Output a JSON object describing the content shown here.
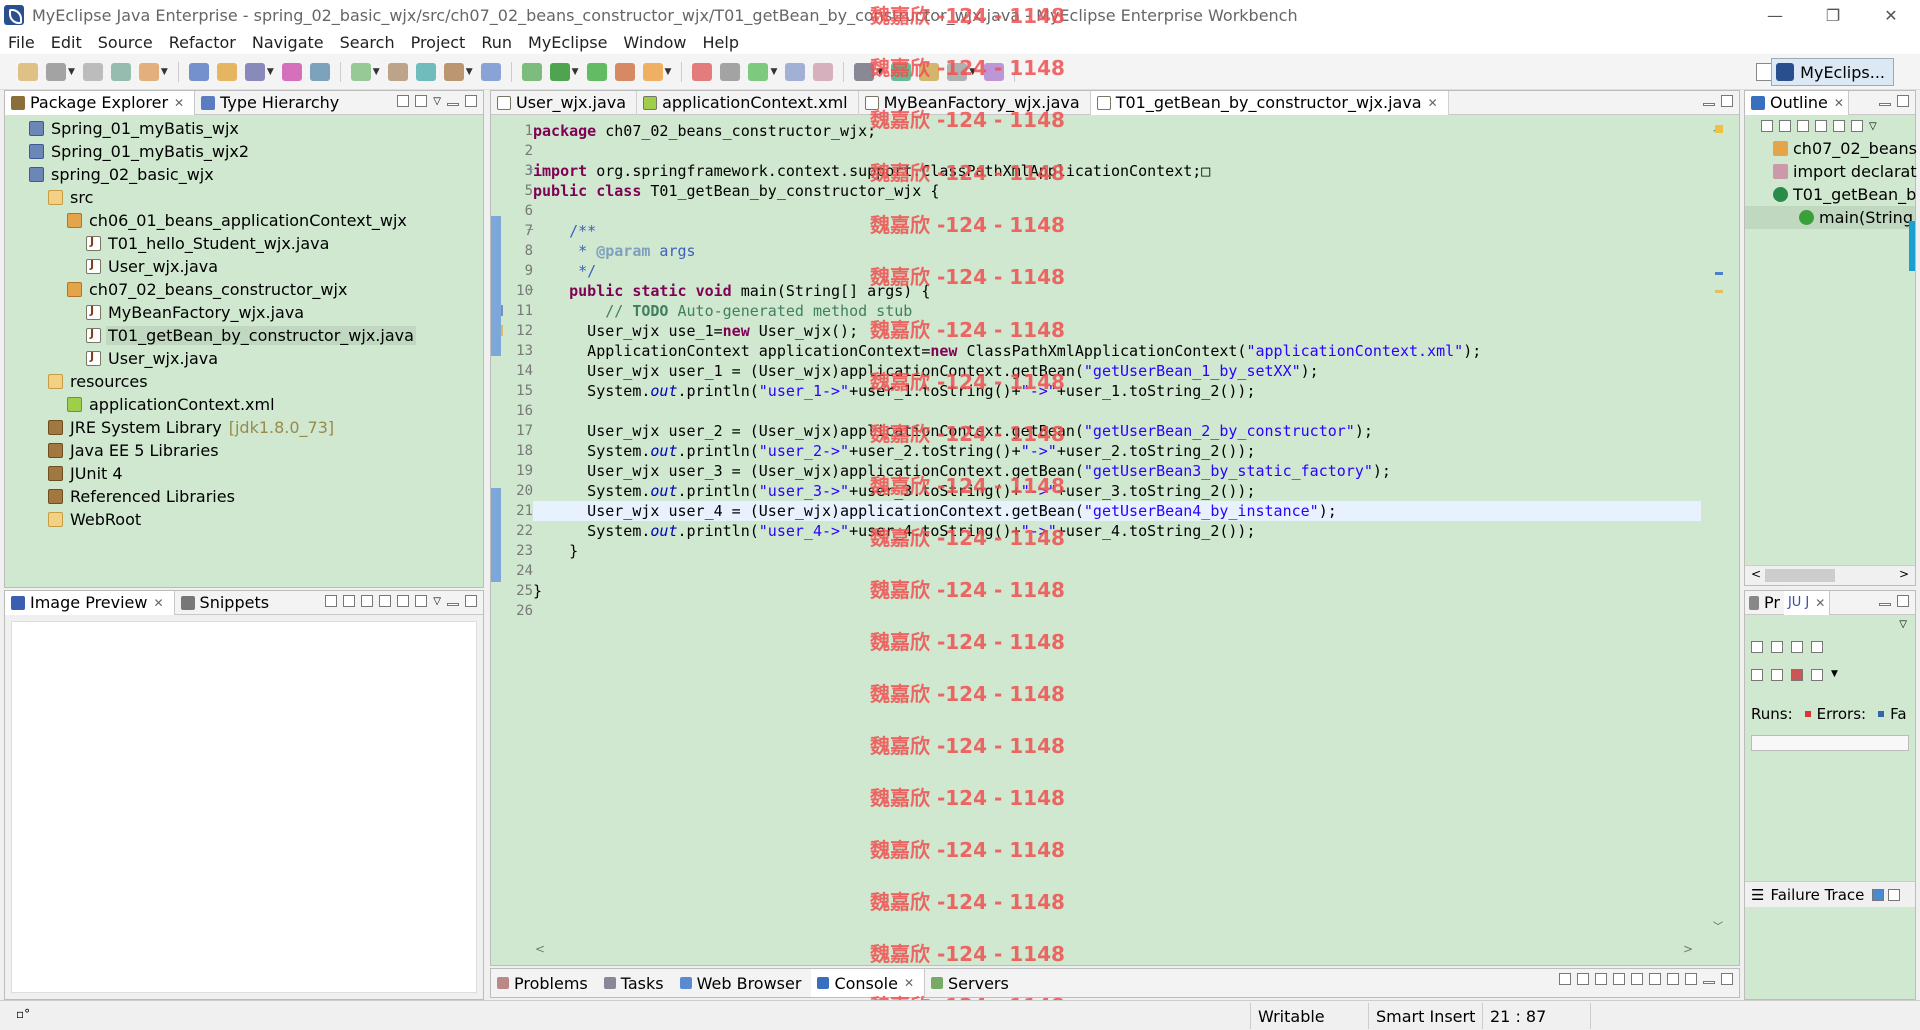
{
  "window": {
    "title": "MyEclipse Java Enterprise - spring_02_basic_wjx/src/ch07_02_beans_constructor_wjx/T01_getBean_by_constructor_wjx.java - MyEclipse Enterprise Workbench",
    "controls": [
      "—",
      "❐",
      "✕"
    ]
  },
  "menu": [
    "File",
    "Edit",
    "Source",
    "Refactor",
    "Navigate",
    "Search",
    "Project",
    "Run",
    "MyEclipse",
    "Window",
    "Help"
  ],
  "perspective": {
    "label": "MyEclips..."
  },
  "package_explorer": {
    "tabs": [
      {
        "label": "Package Explorer"
      },
      {
        "label": "Type Hierarchy"
      }
    ],
    "items": [
      {
        "label": "Spring_01_myBatis_wjx",
        "indent": 0,
        "icon": "project"
      },
      {
        "label": "Spring_01_myBatis_wjx2",
        "indent": 0,
        "icon": "project"
      },
      {
        "label": "spring_02_basic_wjx",
        "indent": 0,
        "icon": "project"
      },
      {
        "label": "src",
        "indent": 1,
        "icon": "folder"
      },
      {
        "label": "ch06_01_beans_applicationContext_wjx",
        "indent": 2,
        "icon": "package"
      },
      {
        "label": "T01_hello_Student_wjx.java",
        "indent": 3,
        "icon": "java-file"
      },
      {
        "label": "User_wjx.java",
        "indent": 3,
        "icon": "java-file"
      },
      {
        "label": "ch07_02_beans_constructor_wjx",
        "indent": 2,
        "icon": "package"
      },
      {
        "label": "MyBeanFactory_wjx.java",
        "indent": 3,
        "icon": "java-file"
      },
      {
        "label": "T01_getBean_by_constructor_wjx.java",
        "indent": 3,
        "icon": "java-file",
        "selected": true
      },
      {
        "label": "User_wjx.java",
        "indent": 3,
        "icon": "java-file"
      },
      {
        "label": "resources",
        "indent": 1,
        "icon": "folder"
      },
      {
        "label": "applicationContext.xml",
        "indent": 2,
        "icon": "xml-file"
      },
      {
        "label": "JRE System Library",
        "decor": "[jdk1.8.0_73]",
        "indent": 1,
        "icon": "library"
      },
      {
        "label": "Java EE 5 Libraries",
        "indent": 1,
        "icon": "library"
      },
      {
        "label": "JUnit 4",
        "indent": 1,
        "icon": "library"
      },
      {
        "label": "Referenced Libraries",
        "indent": 1,
        "icon": "library"
      },
      {
        "label": "WebRoot",
        "indent": 1,
        "icon": "folder"
      }
    ]
  },
  "image_preview": {
    "tabs": [
      {
        "label": "Image Preview"
      },
      {
        "label": "Snippets"
      }
    ]
  },
  "editor": {
    "tabs": [
      {
        "label": "User_wjx.java"
      },
      {
        "label": "applicationContext.xml"
      },
      {
        "label": "MyBeanFactory_wjx.java"
      },
      {
        "label": "T01_getBean_by_constructor_wjx.java",
        "active": true
      }
    ],
    "lines": [
      {
        "n": "1",
        "html": "<span class='kw'>package</span> ch07_02_beans_constructor_wjx;"
      },
      {
        "n": "2",
        "html": ""
      },
      {
        "n": "3",
        "html": "<span class='kw'>import</span> org.springframework.context.support.ClassPathXmlApplicationContext;&#9633;"
      },
      {
        "n": "5",
        "html": "<span class='kw'>public</span> <span class='kw'>class</span> T01_getBean_by_constructor_wjx {"
      },
      {
        "n": "6",
        "html": ""
      },
      {
        "n": "7",
        "html": "    <span class='doc'>/**</span>"
      },
      {
        "n": "8",
        "html": "     <span class='doc'>* </span><span class='doctag'>@param</span><span class='doc'> args</span>"
      },
      {
        "n": "9",
        "html": "     <span class='doc'>*/</span>"
      },
      {
        "n": "10",
        "html": "    <span class='kw'>public</span> <span class='kw'>static</span> <span class='kw'>void</span> main(String[] args) {"
      },
      {
        "n": "11",
        "html": "        <span class='cm'>// <b>TODO</b> Auto-generated method stub</span>"
      },
      {
        "n": "12",
        "html": "      User_wjx use_1=<span class='kw'>new</span> User_wjx();"
      },
      {
        "n": "13",
        "html": "      ApplicationContext applicationContext=<span class='kw'>new</span> ClassPathXmlApplicationContext(<span class='str'>\"applicationContext.xml\"</span>);"
      },
      {
        "n": "14",
        "html": "      User_wjx user_1 = (User_wjx)applicationContext.getBean(<span class='str'>\"getUserBean_1_by_setXX\"</span>);"
      },
      {
        "n": "15",
        "html": "      System.<span class='it'>out</span>.println(<span class='str'>\"user_1-&gt;\"</span>+user_1.toString()+<span class='str'>\"-&gt;\"</span>+user_1.toString_2());"
      },
      {
        "n": "16",
        "html": ""
      },
      {
        "n": "17",
        "html": "      User_wjx user_2 = (User_wjx)applicationContext.getBean(<span class='str'>\"getUserBean_2_by_constructor\"</span>);"
      },
      {
        "n": "18",
        "html": "      System.<span class='it'>out</span>.println(<span class='str'>\"user_2-&gt;\"</span>+user_2.toString()+<span class='str'>\"-&gt;\"</span>+user_2.toString_2());"
      },
      {
        "n": "19",
        "html": "      User_wjx user_3 = (User_wjx)applicationContext.getBean(<span class='str'>\"getUserBean3_by_static_factory\"</span>);"
      },
      {
        "n": "20",
        "html": "      System.<span class='it'>out</span>.println(<span class='str'>\"user_3-&gt;\"</span>+user_3.toString()+<span class='str'>\"-&gt;\"</span>+user_3.toString_2());"
      },
      {
        "n": "21",
        "html": "      User_wjx user_4 = (User_wjx)applicationContext.getBean(<span class='str'>\"getUserBean4_by_instance\"</span>);",
        "current": true
      },
      {
        "n": "22",
        "html": "      System.<span class='it'>out</span>.println(<span class='str'>\"user_4-&gt;\"</span>+user_4.toString()+<span class='str'>\"-&gt;\"</span>+user_4.toString_2());"
      },
      {
        "n": "23",
        "html": "    }"
      },
      {
        "n": "24",
        "html": ""
      },
      {
        "n": "25",
        "html": "}"
      },
      {
        "n": "26",
        "html": ""
      }
    ]
  },
  "outline": {
    "tab": "Outline",
    "items": [
      {
        "label": "ch07_02_beans"
      },
      {
        "label": "import declarat"
      },
      {
        "label": "T01_getBean_b"
      },
      {
        "label": "main(String"
      }
    ]
  },
  "junit": {
    "tabs": [
      "Pr",
      "JU J"
    ],
    "runs_label": "Runs:",
    "errors_label": "Errors:",
    "failures_label": "Fa",
    "failure_trace": "Failure Trace"
  },
  "bottom_tabs": [
    "Problems",
    "Tasks",
    "Web Browser",
    "Console",
    "Servers"
  ],
  "status": {
    "writable": "Writable",
    "insert": "Smart Insert",
    "position": "21 : 87"
  },
  "watermark": "魏嘉欣 -124 - 1148"
}
